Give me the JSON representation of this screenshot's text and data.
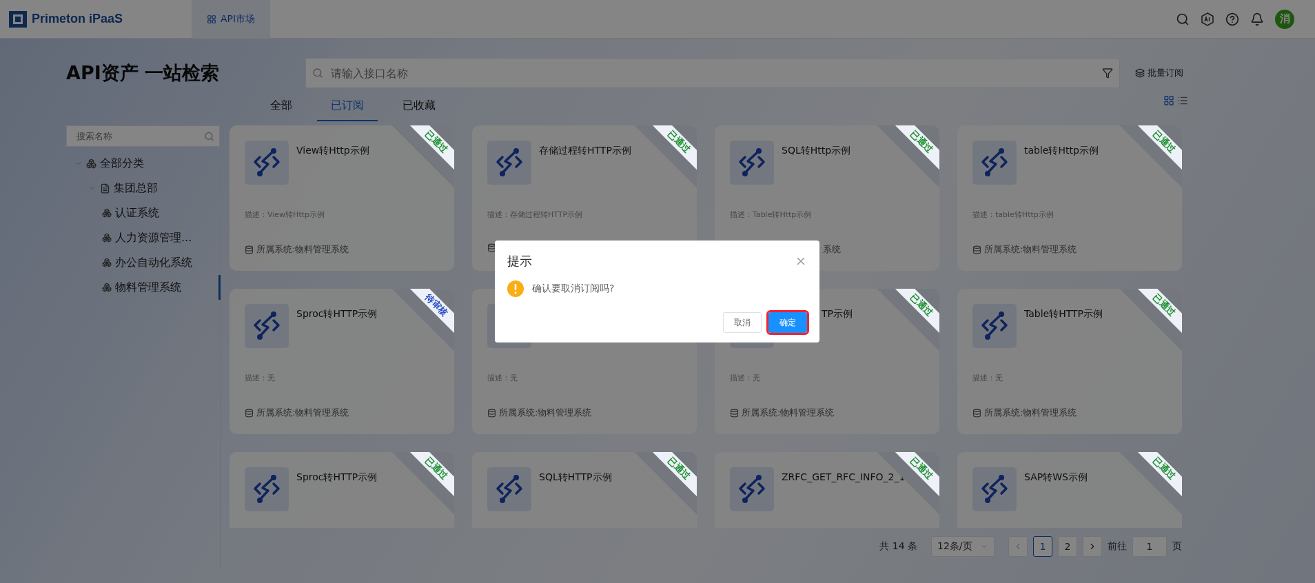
{
  "header": {
    "logo": "Primeton iPaaS",
    "nav": [
      {
        "label": "API市场",
        "selected": true
      }
    ],
    "avatar": "消"
  },
  "page": {
    "title": "API资产 一站检索",
    "search": {
      "placeholder": "请输入接口名称"
    },
    "batch_button": "批量订阅",
    "tabs": [
      {
        "label": "全部",
        "selected": false
      },
      {
        "label": "已订阅",
        "selected": true
      },
      {
        "label": "已收藏",
        "selected": false
      }
    ],
    "view_toggle": [
      {
        "kind": "grid",
        "selected": true
      },
      {
        "kind": "list",
        "selected": false
      }
    ]
  },
  "sidebar": {
    "search": {
      "placeholder": "搜索名称"
    },
    "tree": [
      {
        "label": "全部分类",
        "kind": "category",
        "expanded": true,
        "selected": false,
        "children": [
          {
            "label": "集团总部",
            "kind": "org",
            "expanded": true,
            "selected": false,
            "children": [
              {
                "label": "认证系统",
                "kind": "system",
                "selected": false
              },
              {
                "label": "人力资源管理...",
                "kind": "system",
                "selected": false
              },
              {
                "label": "办公自动化系统",
                "kind": "system",
                "selected": false
              },
              {
                "label": "物料管理系统",
                "kind": "system",
                "selected": true
              }
            ]
          }
        ]
      }
    ]
  },
  "cards": [
    {
      "title": "View转Http示例",
      "status": "已通过",
      "color": "#1a8f2e",
      "description": "描述：View转Http示例",
      "system": "所属系统:物料管理系统"
    },
    {
      "title": "存储过程转HTTP示例",
      "status": "已通过",
      "color": "#1a8f2e",
      "description": "描述：存储过程转HTTP示例",
      "system_icon": true
    },
    {
      "title": "SQL转Http示例",
      "status": "已通过",
      "color": "#1a8f2e",
      "description": "描述：Table转Http示例",
      "system": "系统"
    },
    {
      "title": "table转Http示例",
      "status": "已通过",
      "color": "#1a8f2e",
      "description": "描述：table转Http示例",
      "system": "所属系统:物料管理系统"
    },
    {
      "title": "Sproc转HTTP示例",
      "status": "待审核",
      "color": "#2b4fc7",
      "description": "描述：无",
      "system": "所属系统:物料管理系统"
    },
    {
      "description": "描述：无",
      "system": "所属系统:物料管理系统"
    },
    {
      "title": "TP示例",
      "status": "已通过",
      "color": "#1a8f2e",
      "description": "描述：无",
      "system": "所属系统:物料管理系统"
    },
    {
      "title": "Table转HTTP示例",
      "status": "已通过",
      "color": "#1a8f2e",
      "description": "描述：无",
      "system": "所属系统:物料管理系统"
    },
    {
      "title": "Sproc转HTTP示例",
      "status": "已通过",
      "color": "#1a8f2e"
    },
    {
      "title": "SQL转HTTP示例",
      "status": "已通过",
      "color": "#1a8f2e"
    },
    {
      "title": "ZRFC_GET_RFC_INFO_2_1",
      "status": "已通过",
      "color": "#1a8f2e"
    },
    {
      "title": "SAP转WS示例",
      "status": "已通过",
      "color": "#1a8f2e"
    }
  ],
  "pagination": {
    "total": "共 14 条",
    "page_size": "12条/页",
    "pages": [
      {
        "label": "1",
        "selected": true
      },
      {
        "label": "2",
        "selected": false
      }
    ],
    "goto_label": "前往",
    "goto_value": "1",
    "page_unit": "页",
    "prev_disabled": true
  },
  "dialog": {
    "title": "提示",
    "message": "确认要取消订阅吗?",
    "buttons": [
      {
        "label": "取消",
        "kind": "default"
      },
      {
        "label": "确定",
        "kind": "primary",
        "highlighted": true
      }
    ]
  }
}
